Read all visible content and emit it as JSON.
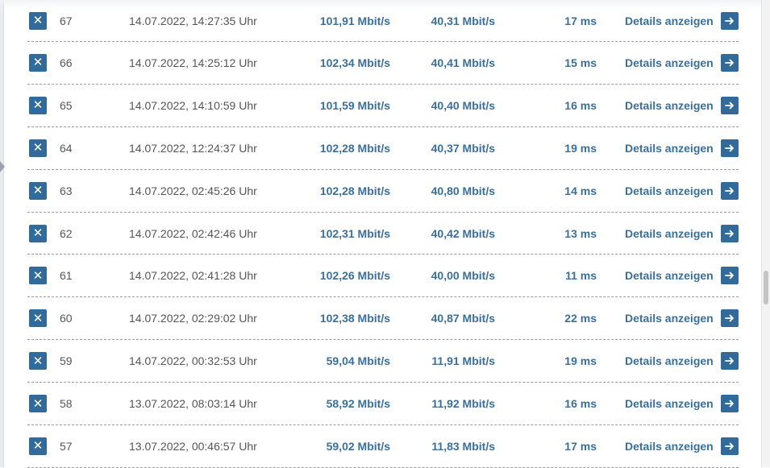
{
  "colors": {
    "accent": "#326a99",
    "value_text": "#3a6f9b",
    "body_text": "#555555"
  },
  "icons": {
    "delete": "close-icon",
    "open": "arrow-right-icon"
  },
  "rows": [
    {
      "id": "67",
      "datetime": "14.07.2022, 14:27:35 Uhr",
      "download": "101,91 Mbit/s",
      "upload": "40,31 Mbit/s",
      "ping": "17 ms",
      "details": "Details anzeigen"
    },
    {
      "id": "66",
      "datetime": "14.07.2022, 14:25:12 Uhr",
      "download": "102,34 Mbit/s",
      "upload": "40,41 Mbit/s",
      "ping": "15 ms",
      "details": "Details anzeigen"
    },
    {
      "id": "65",
      "datetime": "14.07.2022, 14:10:59 Uhr",
      "download": "101,59 Mbit/s",
      "upload": "40,40 Mbit/s",
      "ping": "16 ms",
      "details": "Details anzeigen"
    },
    {
      "id": "64",
      "datetime": "14.07.2022, 12:24:37 Uhr",
      "download": "102,28 Mbit/s",
      "upload": "40,37 Mbit/s",
      "ping": "19 ms",
      "details": "Details anzeigen"
    },
    {
      "id": "63",
      "datetime": "14.07.2022, 02:45:26 Uhr",
      "download": "102,28 Mbit/s",
      "upload": "40,80 Mbit/s",
      "ping": "14 ms",
      "details": "Details anzeigen"
    },
    {
      "id": "62",
      "datetime": "14.07.2022, 02:42:46 Uhr",
      "download": "102,31 Mbit/s",
      "upload": "40,42 Mbit/s",
      "ping": "13 ms",
      "details": "Details anzeigen"
    },
    {
      "id": "61",
      "datetime": "14.07.2022, 02:41:28 Uhr",
      "download": "102,26 Mbit/s",
      "upload": "40,00 Mbit/s",
      "ping": "11 ms",
      "details": "Details anzeigen"
    },
    {
      "id": "60",
      "datetime": "14.07.2022, 02:29:02 Uhr",
      "download": "102,38 Mbit/s",
      "upload": "40,87 Mbit/s",
      "ping": "22 ms",
      "details": "Details anzeigen"
    },
    {
      "id": "59",
      "datetime": "14.07.2022, 00:32:53 Uhr",
      "download": "59,04 Mbit/s",
      "upload": "11,91 Mbit/s",
      "ping": "19 ms",
      "details": "Details anzeigen"
    },
    {
      "id": "58",
      "datetime": "13.07.2022, 08:03:14 Uhr",
      "download": "58,92 Mbit/s",
      "upload": "11,92 Mbit/s",
      "ping": "16 ms",
      "details": "Details anzeigen"
    },
    {
      "id": "57",
      "datetime": "13.07.2022, 00:46:57 Uhr",
      "download": "59,02 Mbit/s",
      "upload": "11,83 Mbit/s",
      "ping": "17 ms",
      "details": "Details anzeigen"
    }
  ]
}
